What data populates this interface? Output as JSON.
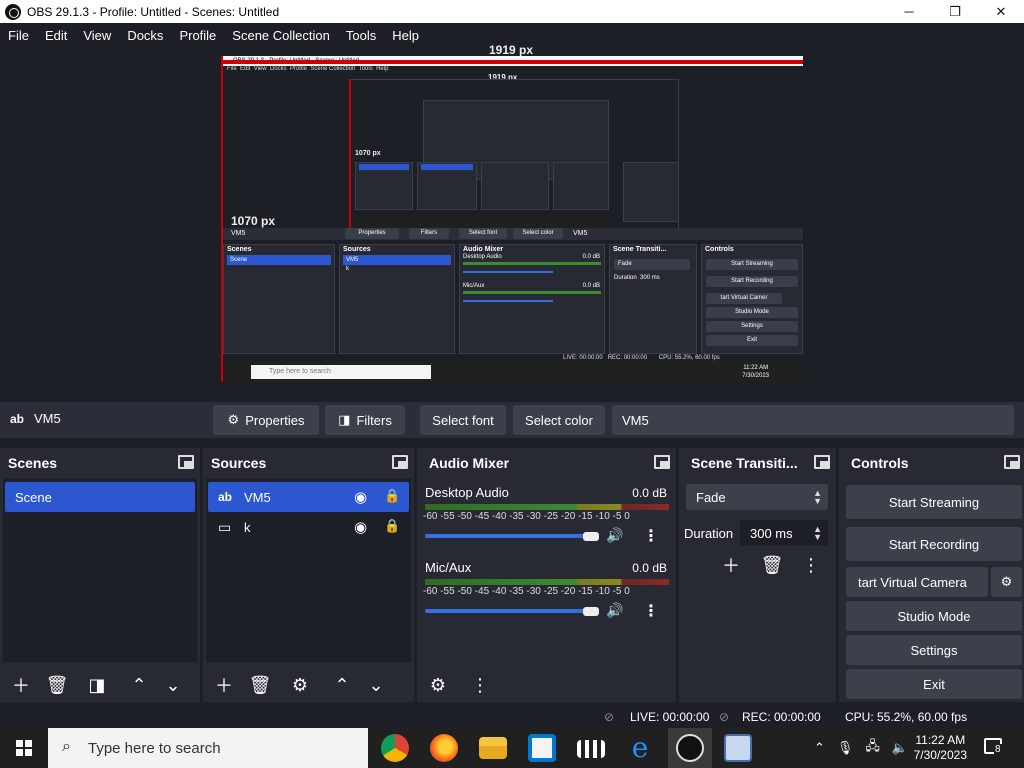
{
  "window": {
    "title": "OBS 29.1.3 - Profile: Untitled - Scenes: Untitled",
    "minimize": "─",
    "maximize": "❐",
    "close": "✕"
  },
  "menu": [
    "File",
    "Edit",
    "View",
    "Docks",
    "Profile",
    "Scene Collection",
    "Tools",
    "Help"
  ],
  "preview": {
    "width_label": "1919 px",
    "height_label": "1070 px",
    "nested_title": "OBS 29.1.3 - Profile: Untitled - Scenes: Untitled",
    "nested_source": "VM5",
    "nested_buttons": [
      "Properties",
      "Filters",
      "Select font",
      "Select color",
      "VM5"
    ],
    "nested_docks": [
      "Scenes",
      "Sources",
      "Audio Mixer",
      "Scene Transiti...",
      "Controls"
    ],
    "nested_scene": "Scene",
    "nested_sources": [
      "VM5",
      "k"
    ],
    "nested_audio": [
      "Desktop Audio",
      "Mic/Aux"
    ],
    "nested_db": "0.0 dB",
    "nested_transition": "Fade",
    "nested_duration_label": "Duration",
    "nested_duration": "300 ms",
    "nested_controls": [
      "Start Streaming",
      "Start Recording",
      "tart Virtual Camer",
      "Studio Mode",
      "Settings",
      "Exit"
    ],
    "nested_status": [
      "LIVE: 00:00:00",
      "REC: 00:00:00",
      "CPU: 55.2%, 60.00 fps"
    ],
    "nested_search": "Type here to search",
    "nested_clock": [
      "11:22 AM",
      "7/30/2023"
    ]
  },
  "source_toolbar": {
    "source_icon": "ab",
    "source_name": "VM5",
    "properties": "Properties",
    "filters": "Filters",
    "select_font": "Select font",
    "select_color": "Select color",
    "text_value": "VM5"
  },
  "scenes": {
    "title": "Scenes",
    "items": [
      "Scene"
    ]
  },
  "sources": {
    "title": "Sources",
    "items": [
      {
        "icon": "ab",
        "name": "VM5"
      },
      {
        "icon": "▭",
        "name": "k"
      }
    ]
  },
  "audio_mixer": {
    "title": "Audio Mixer",
    "channels": [
      {
        "name": "Desktop Audio",
        "db": "0.0 dB"
      },
      {
        "name": "Mic/Aux",
        "db": "0.0 dB"
      }
    ],
    "ticks": "-60 -55 -50 -45 -40 -35 -30 -25 -20 -15 -10  -5   0"
  },
  "transitions": {
    "title": "Scene Transiti...",
    "selected": "Fade",
    "duration_label": "Duration",
    "duration_value": "300 ms"
  },
  "controls": {
    "title": "Controls",
    "buttons": [
      "Start Streaming",
      "Start Recording",
      "tart Virtual Camera",
      "Studio Mode",
      "Settings",
      "Exit"
    ]
  },
  "status": {
    "live": "LIVE: 00:00:00",
    "rec": "REC: 00:00:00",
    "cpu": "CPU: 55.2%, 60.00 fps"
  },
  "taskbar": {
    "search_placeholder": "Type here to search",
    "time": "11:22 AM",
    "date": "7/30/2023",
    "notifications": "8"
  }
}
